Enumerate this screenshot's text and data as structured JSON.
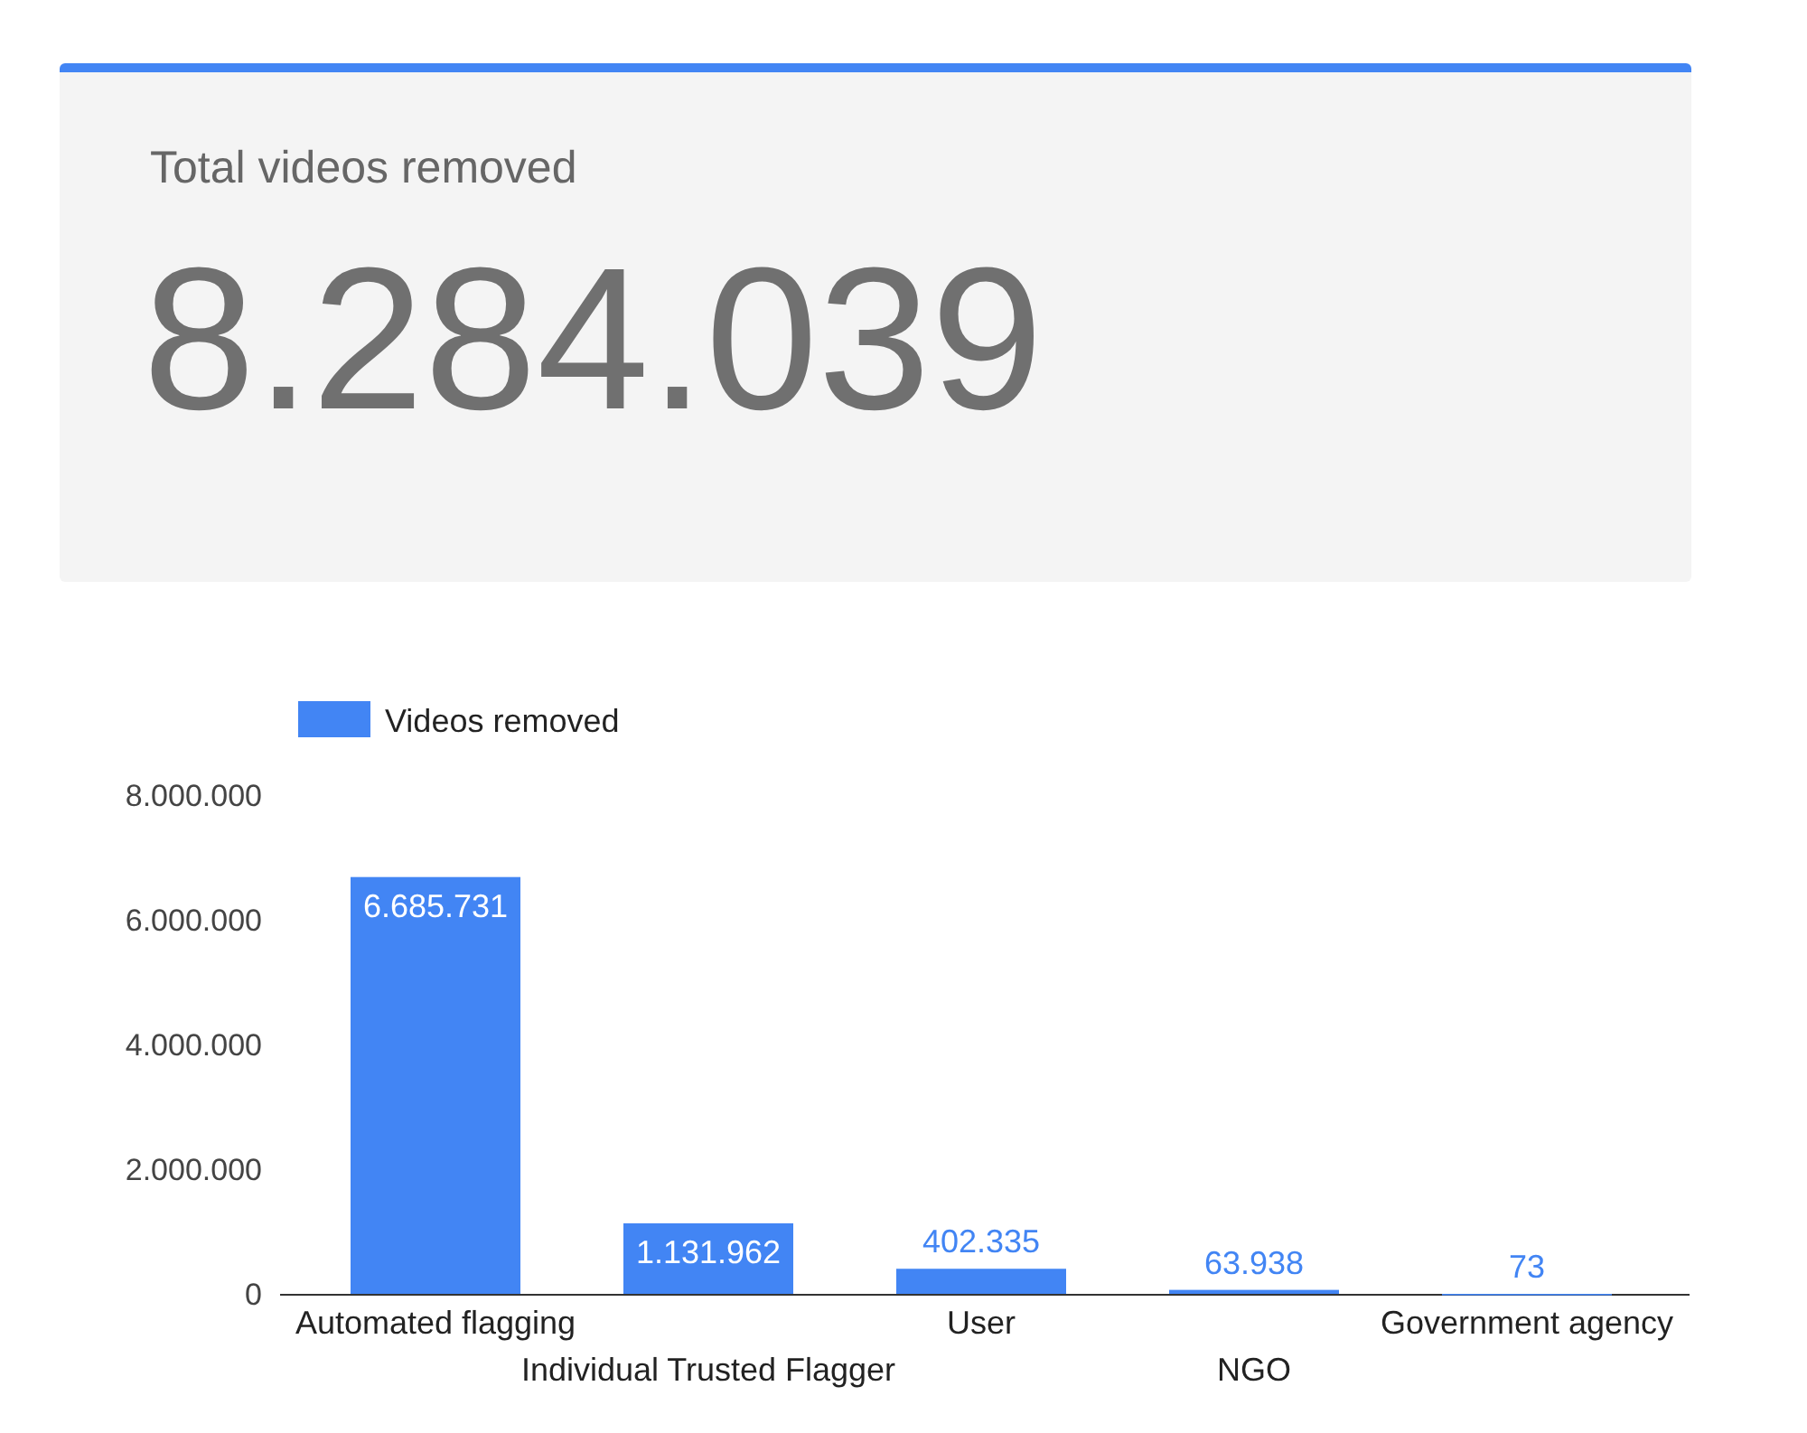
{
  "summary_card": {
    "title": "Total videos removed",
    "value": "8.284.039"
  },
  "chart_data": {
    "type": "bar",
    "categories": [
      "Automated flagging",
      "Individual Trusted Flagger",
      "User",
      "NGO",
      "Government agency"
    ],
    "series": [
      {
        "name": "Videos removed",
        "color": "#4285f4",
        "values": [
          6685731,
          1131962,
          402335,
          63938,
          73
        ]
      }
    ],
    "value_labels": [
      "6.685.731",
      "1.131.962",
      "402.335",
      "63.938",
      "73"
    ],
    "ylim": [
      0,
      8000000
    ],
    "yticks": [
      {
        "value": 0,
        "label": "0"
      },
      {
        "value": 2000000,
        "label": "2.000.000"
      },
      {
        "value": 4000000,
        "label": "4.000.000"
      },
      {
        "value": 6000000,
        "label": "6.000.000"
      },
      {
        "value": 8000000,
        "label": "8.000.000"
      }
    ]
  }
}
